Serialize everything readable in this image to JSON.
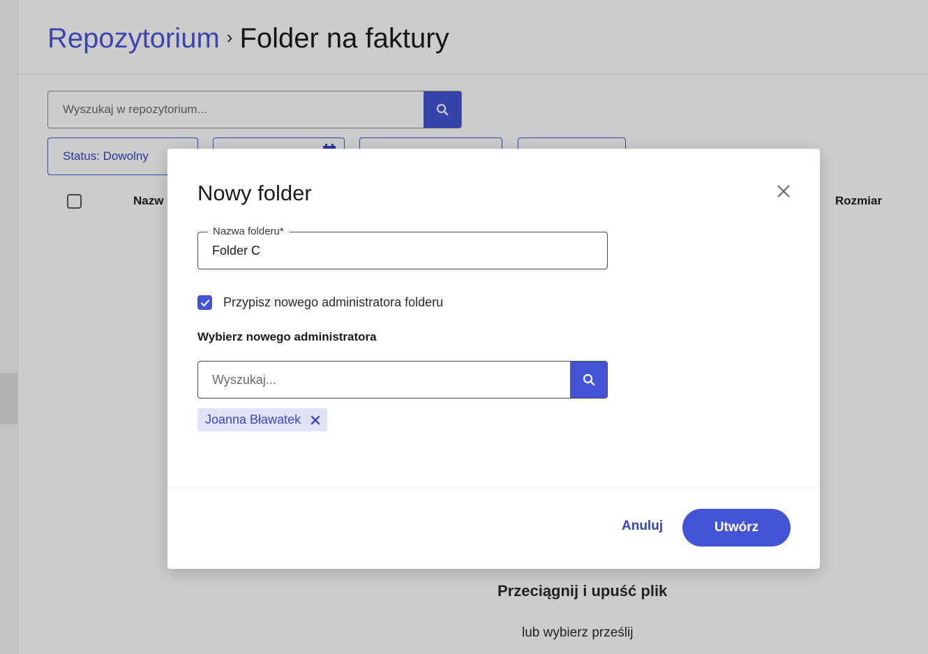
{
  "breadcrumb": {
    "parent": "Repozytorium",
    "separator": "›",
    "current": "Folder na faktury"
  },
  "search": {
    "placeholder": "Wyszukaj w repozytorium...",
    "icon": "search-icon"
  },
  "filters": {
    "status_label": "Status: Dowolny",
    "date_icon": "calendar-icon"
  },
  "table": {
    "columns": [
      "Nazw",
      "Rozmiar"
    ]
  },
  "dropzone": {
    "title": "Przeciągnij i upuść plik",
    "subtitle": "lub wybierz prześlij"
  },
  "modal": {
    "title": "Nowy folder",
    "close_icon": "close-icon",
    "folder_name": {
      "label": "Nazwa folderu*",
      "value": "Folder C"
    },
    "assign_admin": {
      "checked": true,
      "label": "Przypisz nowego administratora folderu"
    },
    "select_admin_label": "Wybierz nowego administratora",
    "admin_search_placeholder": "Wyszukaj...",
    "selected_admins": [
      "Joanna Bławatek"
    ],
    "cancel_label": "Anuluj",
    "create_label": "Utwórz"
  },
  "colors": {
    "accent": "#4454d6",
    "link": "#4a57d9",
    "chip_bg": "#e1e4f8"
  }
}
